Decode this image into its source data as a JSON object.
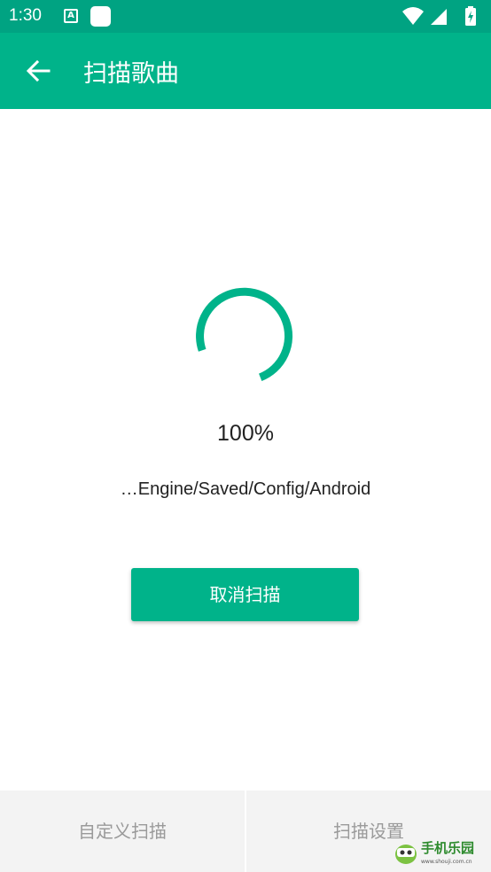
{
  "status_bar": {
    "time": "1:30",
    "icons": [
      "a-notification-icon",
      "app-notification-icon",
      "wifi-icon",
      "signal-icon",
      "battery-charging-icon"
    ]
  },
  "app_bar": {
    "title": "扫描歌曲",
    "back_icon": "arrow-left-icon"
  },
  "scan": {
    "progress_percent": "100%",
    "current_path": "…Engine/Saved/Config/Android",
    "spinner_icon": "loading-spinner-icon"
  },
  "actions": {
    "cancel_label": "取消扫描"
  },
  "bottom_bar": {
    "custom_scan_label": "自定义扫描",
    "scan_settings_label": "扫描设置"
  },
  "watermark": {
    "text": "手机乐园",
    "subtext": "www.shouji.com.cn"
  },
  "colors": {
    "status_bar": "#00a382",
    "accent": "#00b38a",
    "bottom_bar_bg": "#f3f3f3",
    "bottom_bar_text": "#9a9a9a"
  }
}
